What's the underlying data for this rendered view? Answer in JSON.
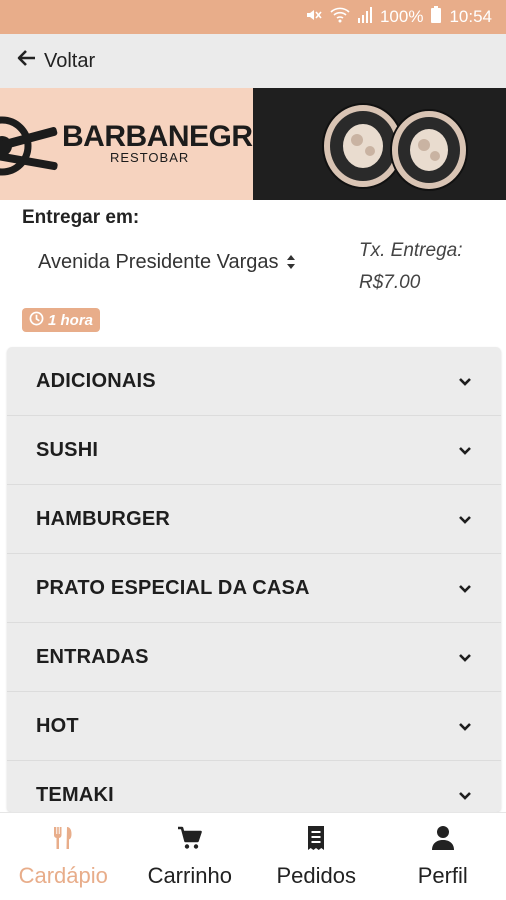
{
  "status_bar": {
    "battery": "100%",
    "time": "10:54"
  },
  "nav": {
    "back_label": "Voltar"
  },
  "banner": {
    "brand_name": "BARBANEGRA",
    "brand_sub": "RESTOBAR"
  },
  "delivery": {
    "title": "Entregar em:",
    "address": "Avenida Presidente Vargas",
    "fee_label": "Tx. Entrega:",
    "fee_value": "R$7.00",
    "time_badge": "1 hora"
  },
  "categories": [
    {
      "label": "ADICIONAIS"
    },
    {
      "label": "SUSHI"
    },
    {
      "label": "HAMBURGER"
    },
    {
      "label": "PRATO ESPECIAL DA CASA"
    },
    {
      "label": "ENTRADAS"
    },
    {
      "label": "HOT"
    },
    {
      "label": "TEMAKI"
    }
  ],
  "bottom_nav": [
    {
      "label": "Cardápio",
      "icon": "utensils-icon",
      "active": true
    },
    {
      "label": "Carrinho",
      "icon": "cart-icon",
      "active": false
    },
    {
      "label": "Pedidos",
      "icon": "receipt-icon",
      "active": false
    },
    {
      "label": "Perfil",
      "icon": "user-icon",
      "active": false
    }
  ],
  "colors": {
    "accent": "#e8ad8a",
    "banner_light": "#f6d3bf",
    "banner_dark": "#1f1f1f"
  }
}
